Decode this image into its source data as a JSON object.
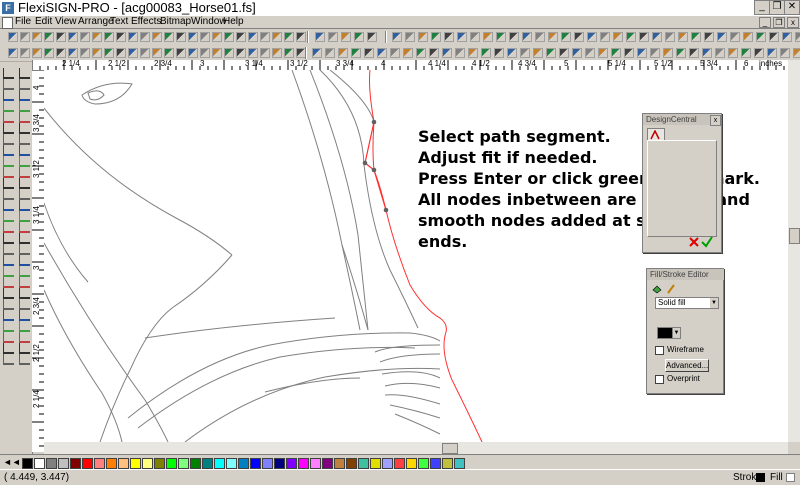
{
  "window": {
    "title": "FlexiSIGN-PRO - [acg00083_Horse01.fs]",
    "min_glyph": "_",
    "restore_glyph": "❐",
    "close_glyph": "✕"
  },
  "menu": {
    "items": [
      "File",
      "Edit",
      "View",
      "Arrange",
      "Text",
      "Effects",
      "Bitmap",
      "Window",
      "Help"
    ]
  },
  "ruler": {
    "top_labels": [
      "2 1/4",
      "2 1/2",
      "2 3/4",
      "3",
      "3 1/4",
      "3 1/2",
      "3 3/4",
      "4",
      "4 1/4",
      "4 1/2",
      "4 3/4",
      "5",
      "5 1/4",
      "5 1/2",
      "5 3/4",
      "6"
    ],
    "unit_label": "inches",
    "left_labels": [
      "4",
      "3 3/4",
      "3 1/2",
      "3 1/4",
      "3",
      "2 3/4",
      "2 1/2",
      "2 1/4"
    ]
  },
  "instructions": [
    "Select path segment.",
    "Adjust fit if needed.",
    "Press Enter or click green checkmark.",
    "All nodes inbetween are deleted and",
    "smooth nodes added at selection",
    "ends."
  ],
  "design_central": {
    "title": "DesignCentral",
    "close_glyph": "x"
  },
  "fill_stroke": {
    "title": "Fill/Stroke Editor",
    "fill_type": "Solid fill",
    "wireframe_label": "Wireframe",
    "advanced_label": "Advanced...",
    "overprint_label": "Overprint"
  },
  "palette": {
    "colors": [
      "#000000",
      "#ffffff",
      "#808080",
      "#c0c0c0",
      "#800000",
      "#ff0000",
      "#ff8080",
      "#ff8000",
      "#ffc080",
      "#ffff00",
      "#ffff80",
      "#808000",
      "#00ff00",
      "#80ff80",
      "#008000",
      "#008080",
      "#00ffff",
      "#80ffff",
      "#0080c0",
      "#0000ff",
      "#8080ff",
      "#000080",
      "#8000ff",
      "#ff00ff",
      "#ff80ff",
      "#800080",
      "#c08040",
      "#804000",
      "#40c0a0",
      "#e0e000",
      "#a0a0ff",
      "#ff4040",
      "#ffd700",
      "#40ff40",
      "#4040ff",
      "#c0c040",
      "#40c0c0"
    ]
  },
  "status": {
    "coords": "(   4.449,      3.447)",
    "stroke_label": "Stroke",
    "fill_label": "Fill"
  },
  "colors": {
    "path_stroke": "#808080",
    "edit_path": "#ff3030",
    "accent_check": "#00a000",
    "cancel_red": "#e00000"
  }
}
